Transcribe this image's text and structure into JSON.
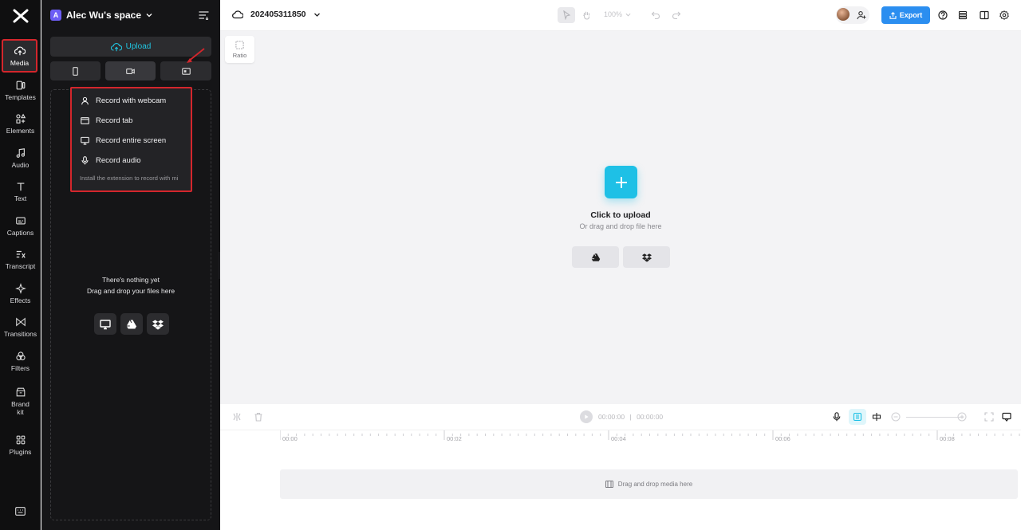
{
  "rail": {
    "items": [
      {
        "label": "Media",
        "icon": "cloud-upload-icon"
      },
      {
        "label": "Templates",
        "icon": "templates-icon"
      },
      {
        "label": "Elements",
        "icon": "elements-icon"
      },
      {
        "label": "Audio",
        "icon": "music-note-icon"
      },
      {
        "label": "Text",
        "icon": "text-icon"
      },
      {
        "label": "Captions",
        "icon": "captions-icon"
      },
      {
        "label": "Transcript",
        "icon": "transcript-icon"
      },
      {
        "label": "Effects",
        "icon": "sparkle-icon"
      },
      {
        "label": "Transitions",
        "icon": "transitions-icon"
      },
      {
        "label": "Filters",
        "icon": "filters-icon"
      },
      {
        "label": "Brand kit",
        "icon": "brand-kit-icon"
      },
      {
        "label": "Plugins",
        "icon": "plugins-icon"
      }
    ]
  },
  "panel": {
    "space_initial": "A",
    "space_name": "Alec Wu's space",
    "upload_label": "Upload",
    "record_menu": {
      "items": [
        {
          "label": "Record with webcam",
          "icon": "person-icon"
        },
        {
          "label": "Record tab",
          "icon": "browser-tab-icon"
        },
        {
          "label": "Record entire screen",
          "icon": "monitor-icon"
        },
        {
          "label": "Record audio",
          "icon": "microphone-icon"
        }
      ],
      "note": "Install the extension to record with mi"
    },
    "empty": {
      "line1": "There's nothing yet",
      "line2": "Drag and drop your files here"
    }
  },
  "topbar": {
    "project_name": "202405311850",
    "zoom": "100%",
    "export_label": "Export"
  },
  "canvas": {
    "ratio_label": "Ratio",
    "click_to_upload": "Click to upload",
    "or_drag": "Or drag and drop file here"
  },
  "timeline": {
    "current_time": "00:00:00",
    "separator": "|",
    "total_time": "00:00:00",
    "ruler": [
      "00:00",
      "00:02",
      "00:04",
      "00:06",
      "00:08"
    ],
    "track_hint": "Drag and drop media here"
  },
  "colors": {
    "accent": "#1ec0e6",
    "export": "#2b8ef0",
    "highlight": "#d4262c"
  }
}
